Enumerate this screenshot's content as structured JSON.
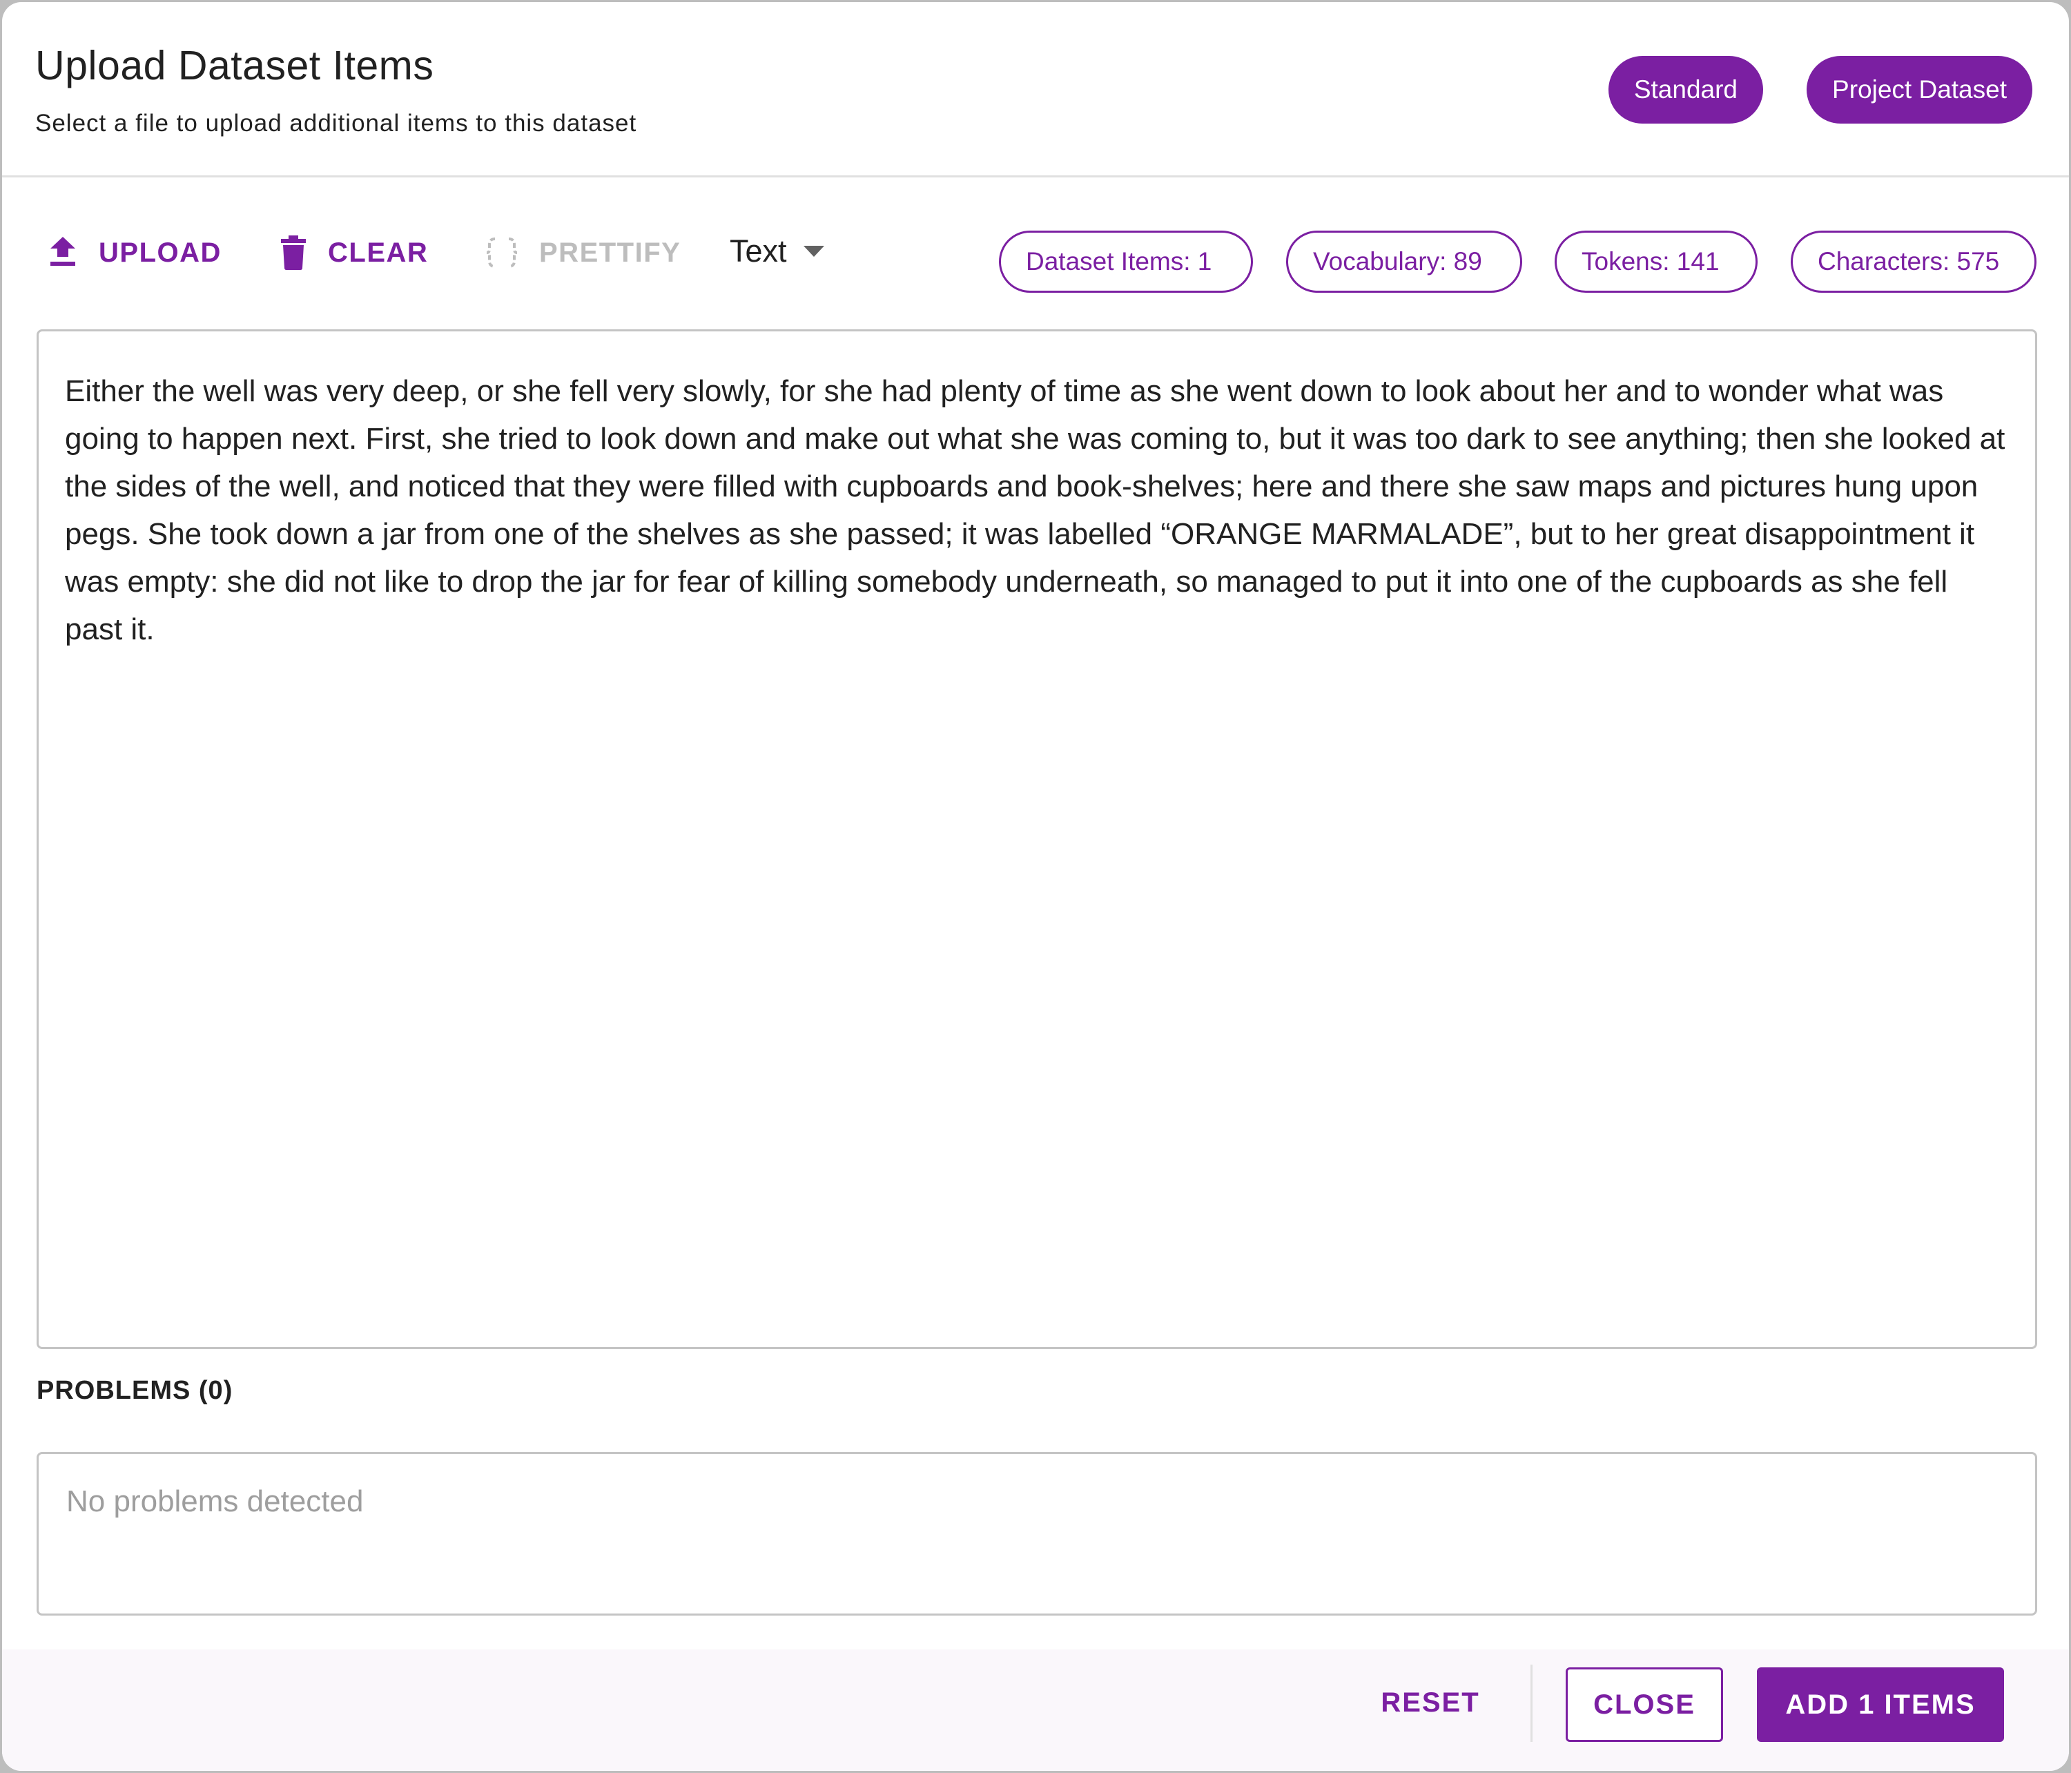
{
  "dialog": {
    "title": "Upload Dataset Items",
    "subtitle": "Select a file to upload additional items to this dataset",
    "chips": {
      "standard": "Standard",
      "project": "Project Dataset"
    }
  },
  "toolbar": {
    "upload_label": "UPLOAD",
    "clear_label": "CLEAR",
    "prettify_label": "PRETTIFY",
    "format_value": "Text",
    "icons": {
      "upload": "upload-icon",
      "clear": "trash-icon",
      "prettify": "braces-icon",
      "format": "caret-down-icon"
    }
  },
  "stats": {
    "items": "Dataset Items: 1",
    "vocabulary": "Vocabulary: 89",
    "tokens": "Tokens: 141",
    "characters": "Characters: 575"
  },
  "editor": {
    "content": "Either the well was very deep, or she fell very slowly, for she had plenty of time as she went down to look about her and to wonder what was going to happen next. First, she tried to look down and make out what she was coming to, but it was too dark to see anything; then she looked at the sides of the well, and noticed that they were filled with cupboards and book-shelves; here and there she saw maps and pictures hung upon pegs. She took down a jar from one of the shelves as she passed; it was labelled “ORANGE MARMALADE”, but to her great disappointment it was empty: she did not like to drop the jar for fear of killing somebody underneath, so managed to put it into one of the cupboards as she fell past it."
  },
  "problems": {
    "label": "PROBLEMS (0)",
    "empty_text": "No problems detected"
  },
  "footer": {
    "reset_label": "RESET",
    "close_label": "CLOSE",
    "add_label": "ADD 1 ITEMS"
  },
  "colors": {
    "accent": "#7b1fa2",
    "disabled": "#bdbdbd",
    "border": "#c4c4c4",
    "footer_bg": "#faf7fb"
  }
}
